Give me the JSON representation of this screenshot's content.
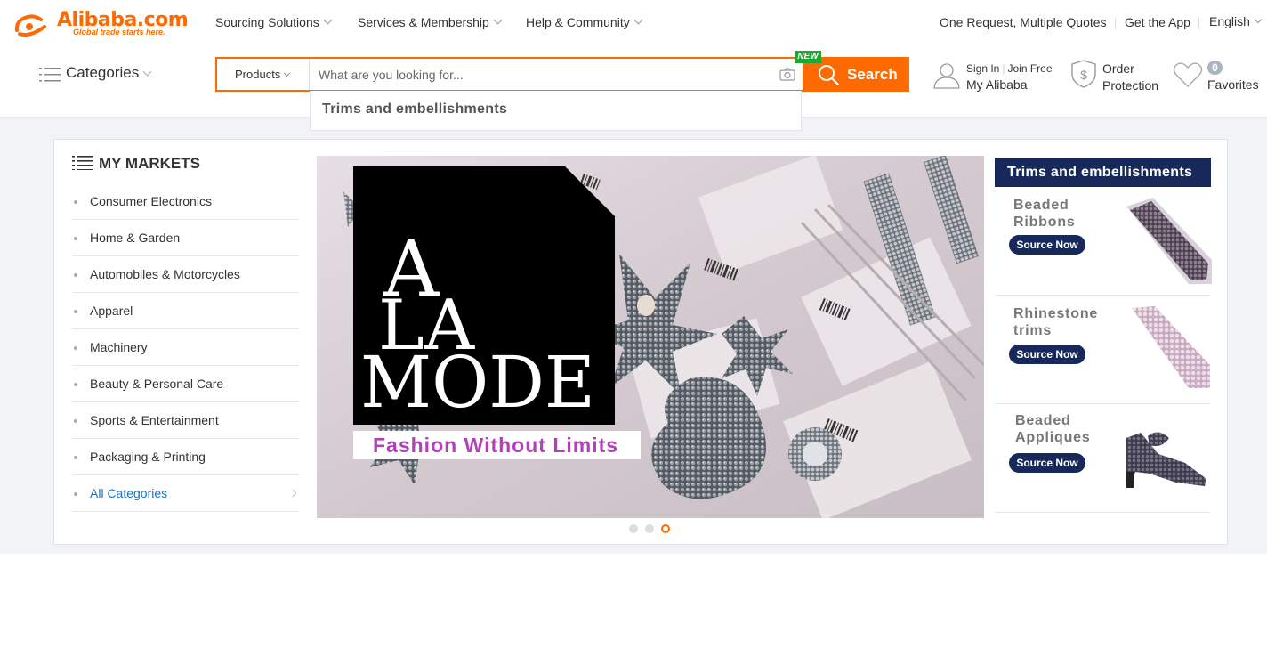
{
  "header": {
    "logo_text": "Alibaba.com",
    "logo_tagline": "Global trade starts here.",
    "nav": [
      "Sourcing Solutions",
      "Services & Membership",
      "Help & Community"
    ],
    "one_request": "One Request, Multiple Quotes",
    "get_app": "Get the App",
    "language": "English",
    "categories_label": "Categories",
    "search": {
      "category": "Products",
      "placeholder": "What are you looking for...",
      "button": "Search",
      "new_badge": "NEW",
      "suggestion": "Trims and embellishments"
    },
    "account": {
      "sign_in": "Sign In",
      "join_free": "Join Free",
      "my_alibaba": "My Alibaba"
    },
    "order_protection": [
      "Order",
      "Protection"
    ],
    "favorites": {
      "count": "0",
      "label": "Favorites"
    }
  },
  "markets": {
    "title": "MY MARKETS",
    "items": [
      "Consumer Electronics",
      "Home & Garden",
      "Automobiles & Motorcycles",
      "Apparel",
      "Machinery",
      "Beauty & Personal Care",
      "Sports & Entertainment",
      "Packaging & Printing"
    ],
    "all_label": "All Categories"
  },
  "banner": {
    "logo_lines": [
      "A",
      "LA",
      "MODE"
    ],
    "tagline": "Fashion Without Limits",
    "slide_count": 3,
    "active_slide": 3
  },
  "rail": {
    "title": "Trims and embellishments",
    "items": [
      {
        "name": [
          "Beaded",
          "Ribbons"
        ],
        "button": "Source Now"
      },
      {
        "name": [
          "Rhinestone",
          "trims"
        ],
        "button": "Source Now"
      },
      {
        "name": [
          "Beaded",
          "Appliques"
        ],
        "button": "Source Now"
      }
    ]
  },
  "colors": {
    "brand": "#ff6a00",
    "navy": "#16295a",
    "link": "#1a73c9",
    "tagline": "#b141b8",
    "new_badge": "#1aaa33"
  }
}
